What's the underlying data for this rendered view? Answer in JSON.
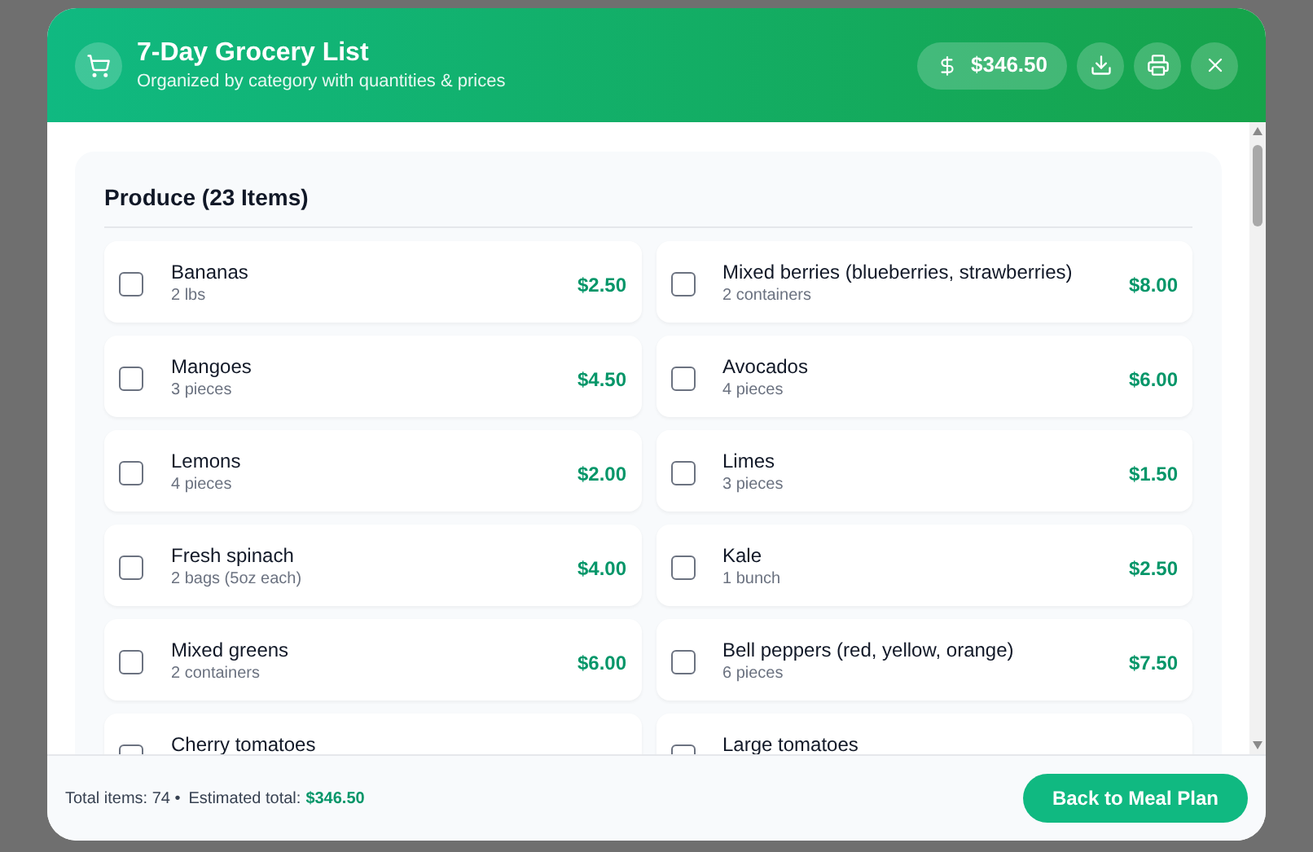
{
  "header": {
    "title": "7-Day Grocery List",
    "subtitle": "Organized by category with quantities & prices",
    "total": "$346.50"
  },
  "category": {
    "title": "Produce (23 Items)",
    "items": [
      {
        "name": "Bananas",
        "quantity": "2 lbs",
        "price": "$2.50",
        "checked": false
      },
      {
        "name": "Mixed berries (blueberries, strawberries)",
        "quantity": "2 containers",
        "price": "$8.00",
        "checked": false
      },
      {
        "name": "Mangoes",
        "quantity": "3 pieces",
        "price": "$4.50",
        "checked": false
      },
      {
        "name": "Avocados",
        "quantity": "4 pieces",
        "price": "$6.00",
        "checked": false
      },
      {
        "name": "Lemons",
        "quantity": "4 pieces",
        "price": "$2.00",
        "checked": false
      },
      {
        "name": "Limes",
        "quantity": "3 pieces",
        "price": "$1.50",
        "checked": false
      },
      {
        "name": "Fresh spinach",
        "quantity": "2 bags (5oz each)",
        "price": "$4.00",
        "checked": false
      },
      {
        "name": "Kale",
        "quantity": "1 bunch",
        "price": "$2.50",
        "checked": false
      },
      {
        "name": "Mixed greens",
        "quantity": "2 containers",
        "price": "$6.00",
        "checked": false
      },
      {
        "name": "Bell peppers (red, yellow, orange)",
        "quantity": "6 pieces",
        "price": "$7.50",
        "checked": false
      },
      {
        "name": "Cherry tomatoes",
        "checked": false
      },
      {
        "name": "Large tomatoes",
        "checked": false
      }
    ]
  },
  "footer": {
    "items_text": "Total items: 74 •",
    "total_label": "Estimated total:",
    "total_value": "$346.50",
    "button": "Back to Meal Plan"
  }
}
